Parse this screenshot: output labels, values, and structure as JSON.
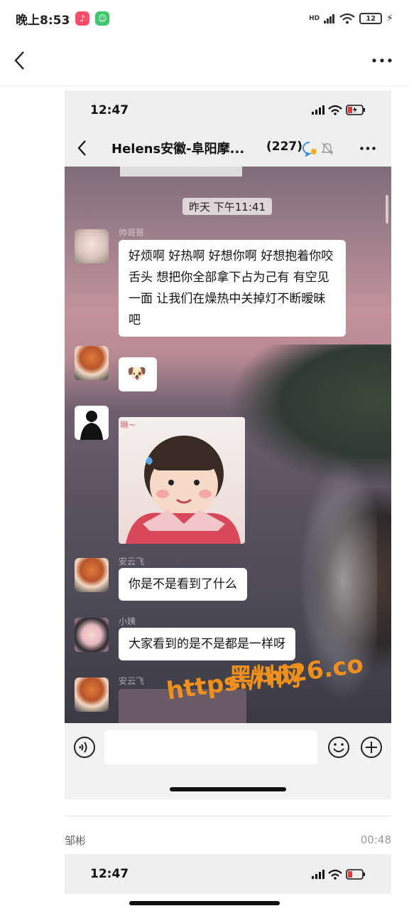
{
  "os_status": {
    "time": "晚上8:53",
    "network": "HD",
    "battery": "12"
  },
  "post": {
    "screenshot": {
      "status_time": "12:47",
      "chat_title": "Helens安徽-阜阳摩...",
      "member_count": "(227)",
      "timestamp": "昨天 下午11:41",
      "messages": [
        {
          "sender": "帅哥哥",
          "text": "好烦啊 好热啊 好想你啊 好想抱着你咬舌头 想把你全部拿下占为己有 有空见一面 让我们在燥热中关掉灯不断暧昧吧"
        },
        {
          "sender": "",
          "emoji": "🐶"
        },
        {
          "sender": "",
          "image_text": "琳~"
        },
        {
          "sender": "安云飞",
          "text": "你是不是看到了什么"
        },
        {
          "sender": "小姨",
          "text": "大家看到的是不是都是一样呀"
        },
        {
          "sender": "安云飞",
          "text": ""
        }
      ]
    },
    "watermark": {
      "line1": "黑料网",
      "line2": "https://hl26.co"
    },
    "author": "邹彬",
    "post_time": "00:48",
    "screenshot2": {
      "status_time": "12:47"
    }
  },
  "colors": {
    "watermark": "#f0901c",
    "bubble": "#ffffff",
    "chat_bg": "#6f5f6e"
  }
}
